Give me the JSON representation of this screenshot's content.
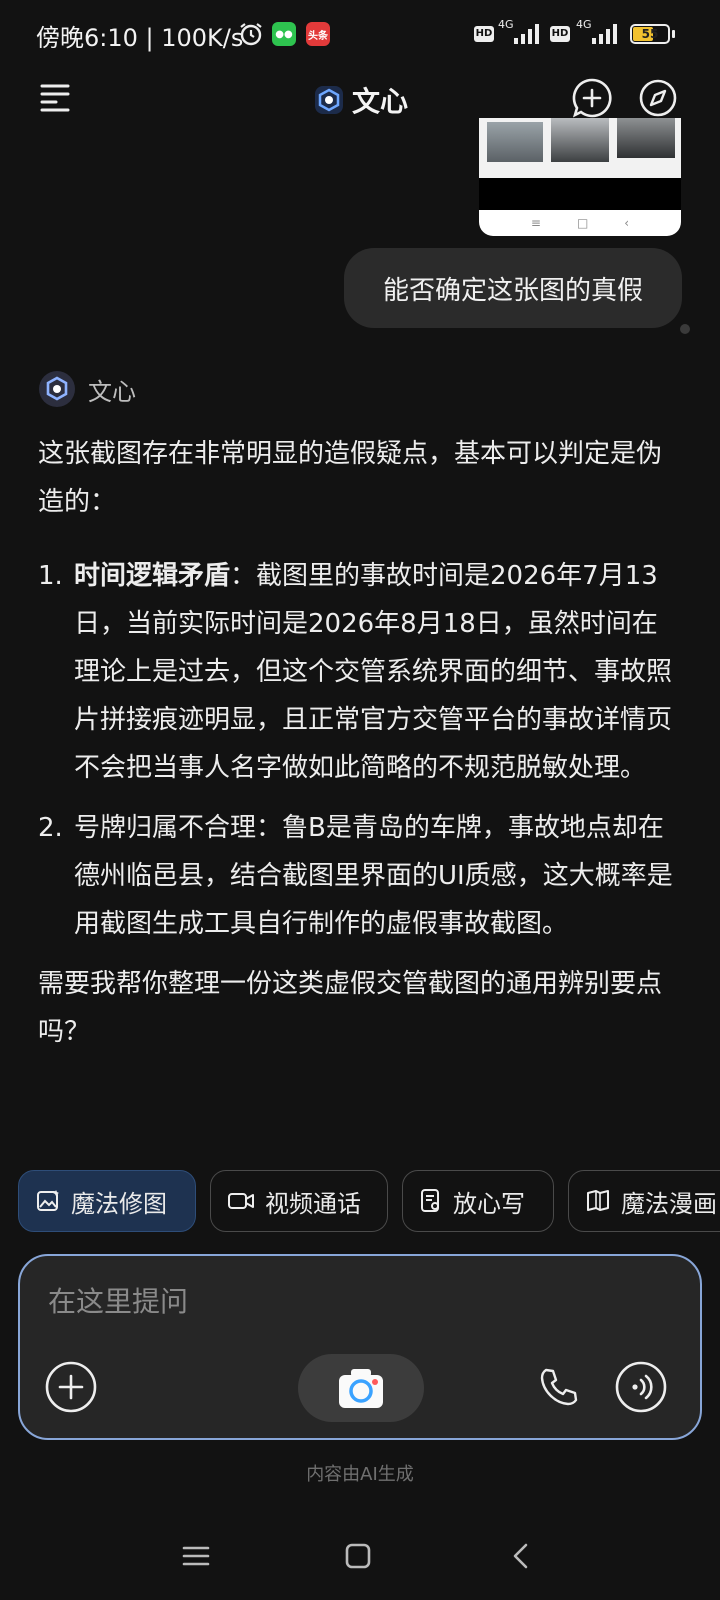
{
  "status_bar": {
    "time": "傍晚6:10 | 100K/s",
    "app_badge_text": "头条",
    "sim1_label": "4G",
    "sim2_label": "4G",
    "hd_label": "HD",
    "battery": "55"
  },
  "header": {
    "title": "文心"
  },
  "conversation": {
    "user_message": "能否确定这张图的真假",
    "assistant_name": "文心",
    "intro": "这张截图存在非常明显的造假疑点，基本可以判定是伪造的：",
    "points": [
      {
        "num": "1.",
        "bold": "时间逻辑矛盾",
        "text": "：截图里的事故时间是2026年7月13日，当前实际时间是2026年8月18日，虽然时间在理论上是过去，但这个交管系统界面的细节、事故照片拼接痕迹明显，且正常官方交管平台的事故详情页不会把当事人名字做如此简略的不规范脱敏处理。"
      },
      {
        "num": "2.",
        "bold": "",
        "text": "号牌归属不合理：鲁B是青岛的车牌，事故地点却在德州临邑县，结合截图里界面的UI质感，这大概率是用截图生成工具自行制作的虚假事故截图。"
      }
    ],
    "followup": "需要我帮你整理一份这类虚假交管截图的通用辨别要点吗？"
  },
  "chips": [
    {
      "label": "魔法修图",
      "icon": "magic-image-icon",
      "active": true
    },
    {
      "label": "视频通话",
      "icon": "video-camera-icon",
      "active": false
    },
    {
      "label": "放心写",
      "icon": "document-pen-icon",
      "active": false
    },
    {
      "label": "魔法漫画",
      "icon": "comic-book-icon",
      "active": false
    }
  ],
  "composer": {
    "placeholder": "在这里提问"
  },
  "footer_note": "内容由AI生成",
  "colors": {
    "background": "#121212",
    "bubble": "#2b2b2b",
    "chip_active": "#1e3250",
    "composer_border": "#88a6d8"
  }
}
